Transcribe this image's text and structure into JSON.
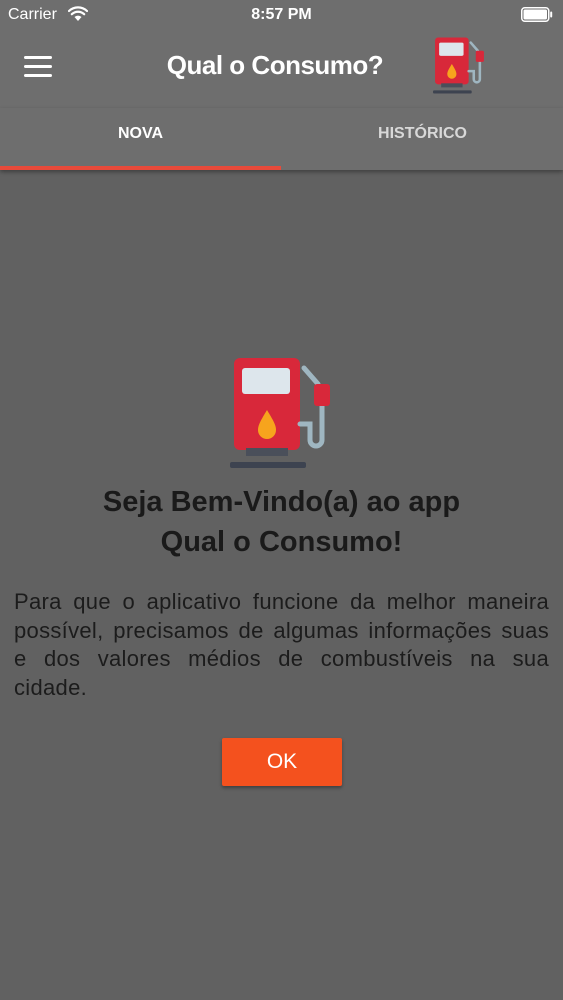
{
  "status_bar": {
    "carrier": "Carrier",
    "time": "8:57 PM"
  },
  "header": {
    "title": "Qual o Consumo?",
    "menu_icon": "hamburger-menu-icon",
    "logo_icon": "fuel-pump-icon"
  },
  "tabs": [
    {
      "label": "NOVA",
      "active": true
    },
    {
      "label": "HISTÓRICO",
      "active": false
    }
  ],
  "welcome": {
    "icon": "fuel-pump-icon",
    "title_line1": "Seja Bem-Vindo(a) ao app",
    "title_line2": "Qual o Consumo!",
    "description": "Para que o aplicativo funcione da melhor maneira possível, precisamos de algumas informações suas e dos valores médios  de combustíveis na sua cidade.",
    "ok_label": "OK"
  },
  "colors": {
    "background": "#616161",
    "header": "#6e6e6e",
    "tab_indicator": "#e84a3a",
    "ok_button": "#f4511e",
    "pump_red": "#d8283a"
  }
}
